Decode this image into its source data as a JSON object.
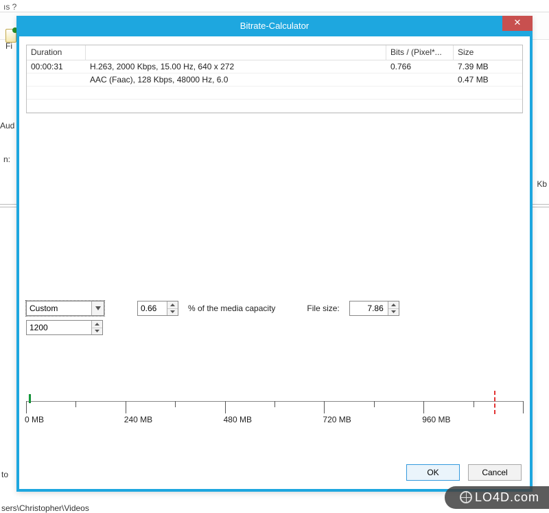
{
  "background": {
    "menu_fragment": "ıs   ?",
    "fi_label": "Fi",
    "aud_label": "Aud",
    "n_label": "n:",
    "kb_label": "Kb",
    "to_label": "to",
    "path_fragment": "sers\\Christopher\\Videos"
  },
  "dialog": {
    "title": "Bitrate-Calculator",
    "close_label": "✕"
  },
  "table": {
    "headers": {
      "duration": "Duration",
      "description": "",
      "bits": "Bits / (Pixel*...",
      "size": "Size"
    },
    "rows": [
      {
        "duration": "00:00:31",
        "description": "H.263, 2000 Kbps, 15.00 Hz, 640 x 272",
        "bits": "0.766",
        "size": "7.39 MB"
      },
      {
        "duration": "",
        "description": "AAC (Faac), 128 Kbps, 48000 Hz, 6.0",
        "bits": "",
        "size": "0.47 MB"
      }
    ]
  },
  "controls": {
    "preset_select": "Custom",
    "bitrate_value": "1200",
    "percent_value": "0.66",
    "percent_label": "% of the media capacity",
    "filesize_label": "File size:",
    "filesize_value": "7.86"
  },
  "ruler": {
    "ticks": [
      "0 MB",
      "240 MB",
      "480 MB",
      "720 MB",
      "960 MB"
    ],
    "marker_mb": 7.86,
    "max_major_value": 1200,
    "dashed_mb": 1130
  },
  "footer": {
    "ok": "OK",
    "cancel": "Cancel"
  },
  "watermark": "LO4D.com"
}
